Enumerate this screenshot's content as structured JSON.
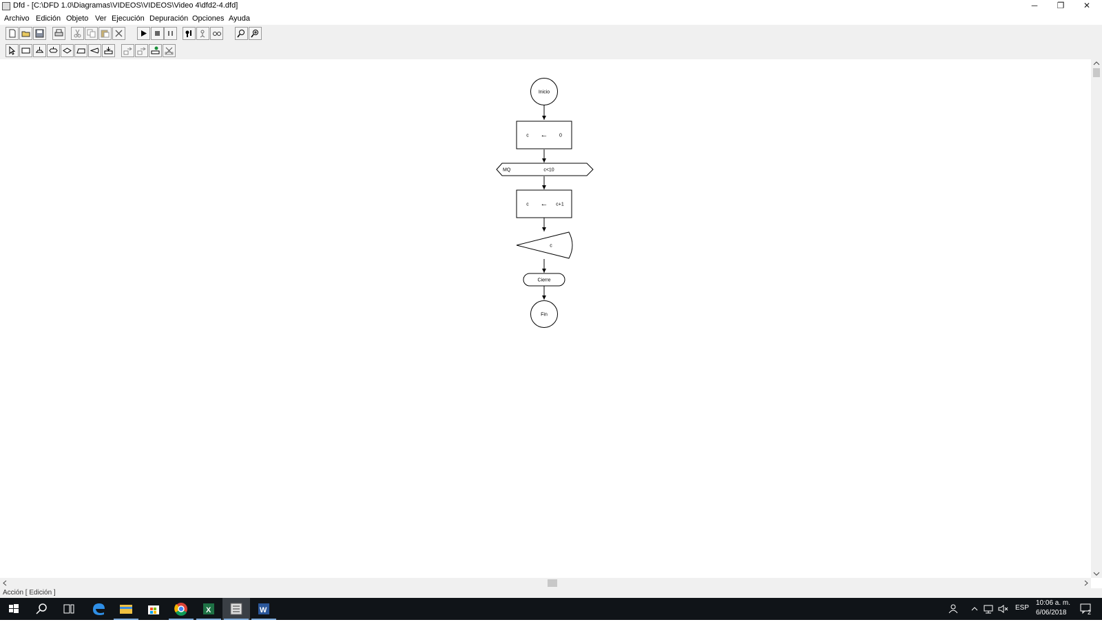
{
  "window": {
    "title": "Dfd - [C:\\DFD 1.0\\Diagramas\\VIDEOS\\VIDEOS\\Video 4\\dfd2-4.dfd]",
    "minimize": "─",
    "restore": "❐",
    "close": "✕"
  },
  "menu": {
    "items": [
      "Archivo",
      "Edición",
      "Objeto",
      "Ver",
      "Ejecución",
      "Depuración",
      "Opciones",
      "Ayuda"
    ]
  },
  "toolbar1": {
    "icons": [
      "new-file-icon",
      "open-folder-icon",
      "save-icon",
      "print-icon",
      "cut-icon",
      "copy-icon",
      "paste-icon",
      "delete-icon",
      "run-icon",
      "stop-icon",
      "pause-icon",
      "step-debug-icon",
      "step-into-icon",
      "watch-icon",
      "zoom-out-icon",
      "zoom-in-icon"
    ]
  },
  "toolbar2": {
    "icons": [
      "select-pointer-icon",
      "assignment-shape-icon",
      "cycle-shape-icon",
      "while-shape-icon",
      "decision-shape-icon",
      "read-shape-icon",
      "write-shape-icon",
      "subroutine-shape-icon",
      "param-in-icon",
      "param-out-icon",
      "call-subroutine-icon",
      "remove-subroutine-icon"
    ]
  },
  "diagram": {
    "start": "Inicio",
    "assign1": {
      "var": "c",
      "arrow": "←",
      "value": "0"
    },
    "while": {
      "keyword": "MQ",
      "condition": "c<10"
    },
    "assign2": {
      "var": "c",
      "arrow": "←",
      "value": "c+1"
    },
    "output": "c",
    "close": "Cierre",
    "end": "Fin"
  },
  "status": {
    "text": "Acción [ Edición ]"
  },
  "taskbar": {
    "apps": [
      "start-icon",
      "search-icon",
      "task-view-icon",
      "edge-icon",
      "file-explorer-icon",
      "store-icon",
      "chrome-icon",
      "excel-icon",
      "dfd-icon",
      "word-icon"
    ],
    "language": "ESP",
    "time": "10:06 a. m.",
    "date": "6/06/2018",
    "notifications": "2"
  }
}
